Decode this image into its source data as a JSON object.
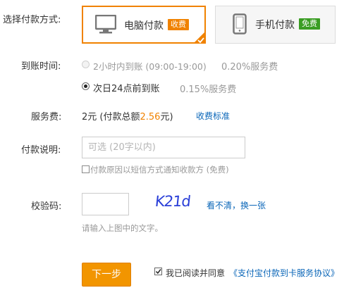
{
  "pay_method": {
    "label": "选择付款方式:",
    "options": [
      {
        "name": "电脑付款",
        "badge": "收费"
      },
      {
        "name": "手机付款",
        "badge": "免费"
      }
    ]
  },
  "arrival": {
    "label": "到账时间:",
    "options": [
      {
        "text": "2小时内到账 (09:00-19:00)",
        "fee": "0.20%服务费"
      },
      {
        "text": "次日24点前到账",
        "fee": "0.15%服务费"
      }
    ]
  },
  "service_fee": {
    "label": "服务费:",
    "prefix": "2元 (付款总额",
    "amount": "2.56",
    "suffix": "元)",
    "link": "收费标准"
  },
  "note": {
    "label": "付款说明:",
    "placeholder": "可选 (20字以内)",
    "sms_option": "付款原因以短信方式通知收款方 (免费)"
  },
  "captcha": {
    "label": "校验码:",
    "image_text": "K21d",
    "refresh": "看不清，换一张",
    "hint": "请输入上图中的文字。"
  },
  "footer": {
    "next": "下一步",
    "agree": "我已阅读并同意",
    "agreement": "《支付宝付款到卡服务协议》"
  },
  "colors": {
    "accent": "#f08200",
    "badge_pay": "#f08200",
    "badge_free": "#3a9d23",
    "link": "#0a66b8",
    "amount": "#f08200"
  }
}
